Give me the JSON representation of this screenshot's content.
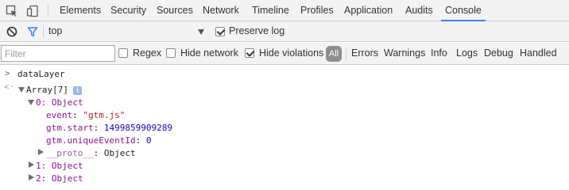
{
  "tabs": [
    {
      "label": "Elements"
    },
    {
      "label": "Security"
    },
    {
      "label": "Sources"
    },
    {
      "label": "Network"
    },
    {
      "label": "Timeline"
    },
    {
      "label": "Profiles"
    },
    {
      "label": "Application"
    },
    {
      "label": "Audits"
    },
    {
      "label": "Console",
      "active": true
    }
  ],
  "icons": {
    "inspect": "inspect-element-icon",
    "device": "device-toolbar-icon",
    "clear": "clear-console-icon",
    "filter": "filter-icon",
    "dropdown": "chevron-down-icon"
  },
  "context": {
    "selected": "top",
    "preserve_log_label": "Preserve log",
    "preserve_log_checked": true
  },
  "filter": {
    "placeholder": "Filter",
    "value": "",
    "regex_label": "Regex",
    "regex_checked": false,
    "hide_network_label": "Hide network",
    "hide_network_checked": false,
    "hide_violations_label": "Hide violations",
    "hide_violations_checked": true,
    "levels": [
      "All",
      "Errors",
      "Warnings",
      "Info",
      "Logs",
      "Debug",
      "Handled"
    ]
  },
  "console": {
    "input_command": "dataLayer",
    "result_header": "Array[7]",
    "info_badge": "i",
    "item0_header": "0: Object",
    "event_key": "event",
    "event_value": "\"gtm.js\"",
    "start_key": "gtm.start",
    "start_value": "1499859909289",
    "unique_key": "gtm.uniqueEventId",
    "unique_value": "0",
    "proto_key": "__proto__",
    "proto_value": "Object",
    "item1": "1: Object",
    "item2": "2: Object"
  },
  "colors": {
    "accent": "#3e82f7",
    "toolbar_bg": "#f3f3f3",
    "property": "#881391",
    "string": "#c41a16",
    "number": "#1c00cf"
  }
}
